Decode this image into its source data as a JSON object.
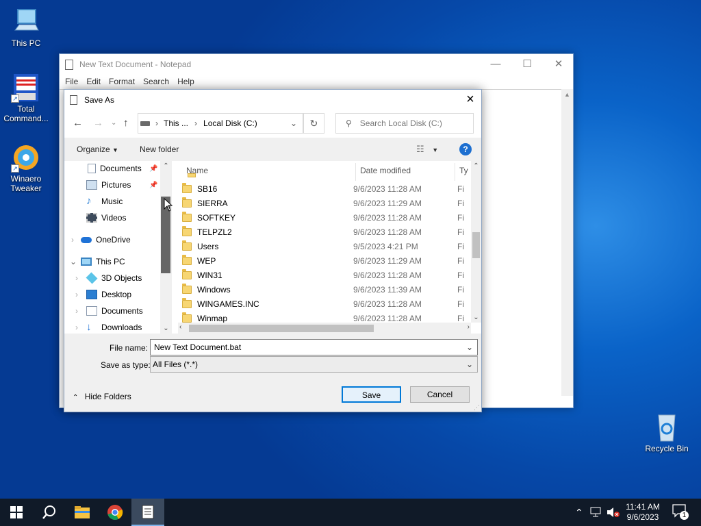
{
  "desktop": {
    "icons": [
      {
        "label": "This PC",
        "icon": "computer-icon"
      },
      {
        "label": "Total Command...",
        "icon": "total-commander-icon"
      },
      {
        "label": "Winaero Tweaker",
        "icon": "winaero-tweaker-icon"
      },
      {
        "label": "Recycle Bin",
        "icon": "recycle-bin-icon"
      }
    ]
  },
  "notepad": {
    "title": "New Text Document - Notepad",
    "menu": [
      "File",
      "Edit",
      "Format",
      "Search",
      "Help"
    ]
  },
  "dialog": {
    "title": "Save As",
    "breadcrumb": [
      "This ...",
      "Local Disk (C:)"
    ],
    "search_placeholder": "Search Local Disk (C:)",
    "toolbar": {
      "organize": "Organize",
      "new_folder": "New folder"
    },
    "tree": [
      {
        "label": "Documents",
        "pinned": true
      },
      {
        "label": "Pictures",
        "pinned": true
      },
      {
        "label": "Music"
      },
      {
        "label": "Videos"
      },
      {
        "label": "OneDrive"
      },
      {
        "label": "This PC"
      },
      {
        "label": "3D Objects"
      },
      {
        "label": "Desktop"
      },
      {
        "label": "Documents"
      },
      {
        "label": "Downloads"
      }
    ],
    "columns": {
      "name": "Name",
      "date": "Date modified",
      "type": "Ty"
    },
    "files": [
      {
        "name": "SB16",
        "date": "9/6/2023 11:28 AM",
        "type": "Fi"
      },
      {
        "name": "SIERRA",
        "date": "9/6/2023 11:29 AM",
        "type": "Fi"
      },
      {
        "name": "SOFTKEY",
        "date": "9/6/2023 11:28 AM",
        "type": "Fi"
      },
      {
        "name": "TELPZL2",
        "date": "9/6/2023 11:28 AM",
        "type": "Fi"
      },
      {
        "name": "Users",
        "date": "9/5/2023 4:21 PM",
        "type": "Fi"
      },
      {
        "name": "WEP",
        "date": "9/6/2023 11:29 AM",
        "type": "Fi"
      },
      {
        "name": "WIN31",
        "date": "9/6/2023 11:28 AM",
        "type": "Fi"
      },
      {
        "name": "Windows",
        "date": "9/6/2023 11:39 AM",
        "type": "Fi"
      },
      {
        "name": "WINGAMES.INC",
        "date": "9/6/2023 11:28 AM",
        "type": "Fi"
      },
      {
        "name": "Winmap",
        "date": "9/6/2023 11:28 AM",
        "type": "Fi"
      }
    ],
    "file_name_label": "File name:",
    "file_name_value": "New Text Document.bat",
    "save_type_label": "Save as type:",
    "save_type_value": "All Files  (*.*)",
    "hide_folders": "Hide Folders",
    "save": "Save",
    "cancel": "Cancel"
  },
  "taskbar": {
    "time": "11:41 AM",
    "date": "9/6/2023",
    "notification_count": "1"
  }
}
